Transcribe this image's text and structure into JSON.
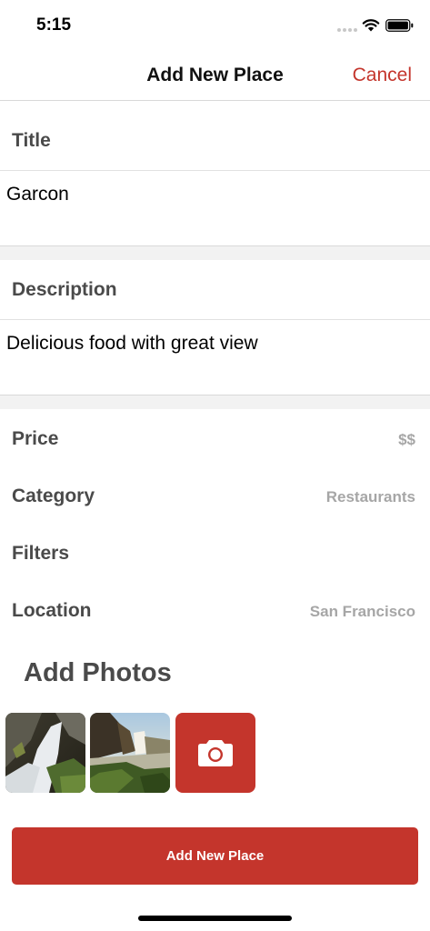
{
  "status_bar": {
    "time": "5:15"
  },
  "nav": {
    "title": "Add New Place",
    "cancel_label": "Cancel"
  },
  "title_section": {
    "label": "Title",
    "value": "Garcon"
  },
  "description_section": {
    "label": "Description",
    "value": "Delicious food with great view"
  },
  "rows": [
    {
      "label": "Price",
      "value": "$$"
    },
    {
      "label": "Category",
      "value": "Restaurants"
    },
    {
      "label": "Filters",
      "value": ""
    },
    {
      "label": "Location",
      "value": "San Francisco"
    }
  ],
  "photos": {
    "title": "Add Photos",
    "icons": [
      "waterfall-photo",
      "waterfall-photo",
      "camera-icon"
    ]
  },
  "submit": {
    "label": "Add New Place"
  },
  "colors": {
    "accent": "#c4352c",
    "label_gray": "#4a4a4a",
    "value_gray": "#a6a6a6"
  }
}
